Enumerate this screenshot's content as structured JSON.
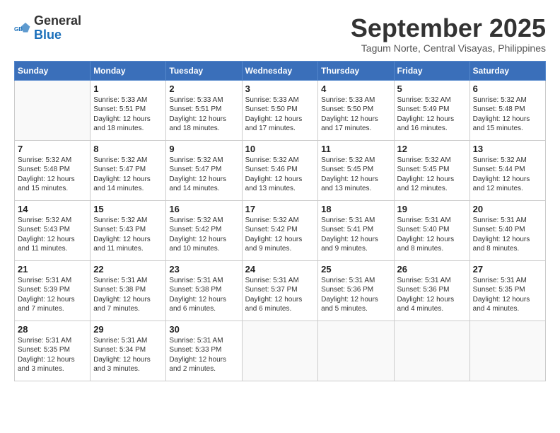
{
  "logo": {
    "general": "General",
    "blue": "Blue"
  },
  "title": "September 2025",
  "subtitle": "Tagum Norte, Central Visayas, Philippines",
  "weekdays": [
    "Sunday",
    "Monday",
    "Tuesday",
    "Wednesday",
    "Thursday",
    "Friday",
    "Saturday"
  ],
  "weeks": [
    [
      {
        "day": "",
        "info": ""
      },
      {
        "day": "1",
        "info": "Sunrise: 5:33 AM\nSunset: 5:51 PM\nDaylight: 12 hours\nand 18 minutes."
      },
      {
        "day": "2",
        "info": "Sunrise: 5:33 AM\nSunset: 5:51 PM\nDaylight: 12 hours\nand 18 minutes."
      },
      {
        "day": "3",
        "info": "Sunrise: 5:33 AM\nSunset: 5:50 PM\nDaylight: 12 hours\nand 17 minutes."
      },
      {
        "day": "4",
        "info": "Sunrise: 5:33 AM\nSunset: 5:50 PM\nDaylight: 12 hours\nand 17 minutes."
      },
      {
        "day": "5",
        "info": "Sunrise: 5:32 AM\nSunset: 5:49 PM\nDaylight: 12 hours\nand 16 minutes."
      },
      {
        "day": "6",
        "info": "Sunrise: 5:32 AM\nSunset: 5:48 PM\nDaylight: 12 hours\nand 15 minutes."
      }
    ],
    [
      {
        "day": "7",
        "info": "Sunrise: 5:32 AM\nSunset: 5:48 PM\nDaylight: 12 hours\nand 15 minutes."
      },
      {
        "day": "8",
        "info": "Sunrise: 5:32 AM\nSunset: 5:47 PM\nDaylight: 12 hours\nand 14 minutes."
      },
      {
        "day": "9",
        "info": "Sunrise: 5:32 AM\nSunset: 5:47 PM\nDaylight: 12 hours\nand 14 minutes."
      },
      {
        "day": "10",
        "info": "Sunrise: 5:32 AM\nSunset: 5:46 PM\nDaylight: 12 hours\nand 13 minutes."
      },
      {
        "day": "11",
        "info": "Sunrise: 5:32 AM\nSunset: 5:45 PM\nDaylight: 12 hours\nand 13 minutes."
      },
      {
        "day": "12",
        "info": "Sunrise: 5:32 AM\nSunset: 5:45 PM\nDaylight: 12 hours\nand 12 minutes."
      },
      {
        "day": "13",
        "info": "Sunrise: 5:32 AM\nSunset: 5:44 PM\nDaylight: 12 hours\nand 12 minutes."
      }
    ],
    [
      {
        "day": "14",
        "info": "Sunrise: 5:32 AM\nSunset: 5:43 PM\nDaylight: 12 hours\nand 11 minutes."
      },
      {
        "day": "15",
        "info": "Sunrise: 5:32 AM\nSunset: 5:43 PM\nDaylight: 12 hours\nand 11 minutes."
      },
      {
        "day": "16",
        "info": "Sunrise: 5:32 AM\nSunset: 5:42 PM\nDaylight: 12 hours\nand 10 minutes."
      },
      {
        "day": "17",
        "info": "Sunrise: 5:32 AM\nSunset: 5:42 PM\nDaylight: 12 hours\nand 9 minutes."
      },
      {
        "day": "18",
        "info": "Sunrise: 5:31 AM\nSunset: 5:41 PM\nDaylight: 12 hours\nand 9 minutes."
      },
      {
        "day": "19",
        "info": "Sunrise: 5:31 AM\nSunset: 5:40 PM\nDaylight: 12 hours\nand 8 minutes."
      },
      {
        "day": "20",
        "info": "Sunrise: 5:31 AM\nSunset: 5:40 PM\nDaylight: 12 hours\nand 8 minutes."
      }
    ],
    [
      {
        "day": "21",
        "info": "Sunrise: 5:31 AM\nSunset: 5:39 PM\nDaylight: 12 hours\nand 7 minutes."
      },
      {
        "day": "22",
        "info": "Sunrise: 5:31 AM\nSunset: 5:38 PM\nDaylight: 12 hours\nand 7 minutes."
      },
      {
        "day": "23",
        "info": "Sunrise: 5:31 AM\nSunset: 5:38 PM\nDaylight: 12 hours\nand 6 minutes."
      },
      {
        "day": "24",
        "info": "Sunrise: 5:31 AM\nSunset: 5:37 PM\nDaylight: 12 hours\nand 6 minutes."
      },
      {
        "day": "25",
        "info": "Sunrise: 5:31 AM\nSunset: 5:36 PM\nDaylight: 12 hours\nand 5 minutes."
      },
      {
        "day": "26",
        "info": "Sunrise: 5:31 AM\nSunset: 5:36 PM\nDaylight: 12 hours\nand 4 minutes."
      },
      {
        "day": "27",
        "info": "Sunrise: 5:31 AM\nSunset: 5:35 PM\nDaylight: 12 hours\nand 4 minutes."
      }
    ],
    [
      {
        "day": "28",
        "info": "Sunrise: 5:31 AM\nSunset: 5:35 PM\nDaylight: 12 hours\nand 3 minutes."
      },
      {
        "day": "29",
        "info": "Sunrise: 5:31 AM\nSunset: 5:34 PM\nDaylight: 12 hours\nand 3 minutes."
      },
      {
        "day": "30",
        "info": "Sunrise: 5:31 AM\nSunset: 5:33 PM\nDaylight: 12 hours\nand 2 minutes."
      },
      {
        "day": "",
        "info": ""
      },
      {
        "day": "",
        "info": ""
      },
      {
        "day": "",
        "info": ""
      },
      {
        "day": "",
        "info": ""
      }
    ]
  ]
}
